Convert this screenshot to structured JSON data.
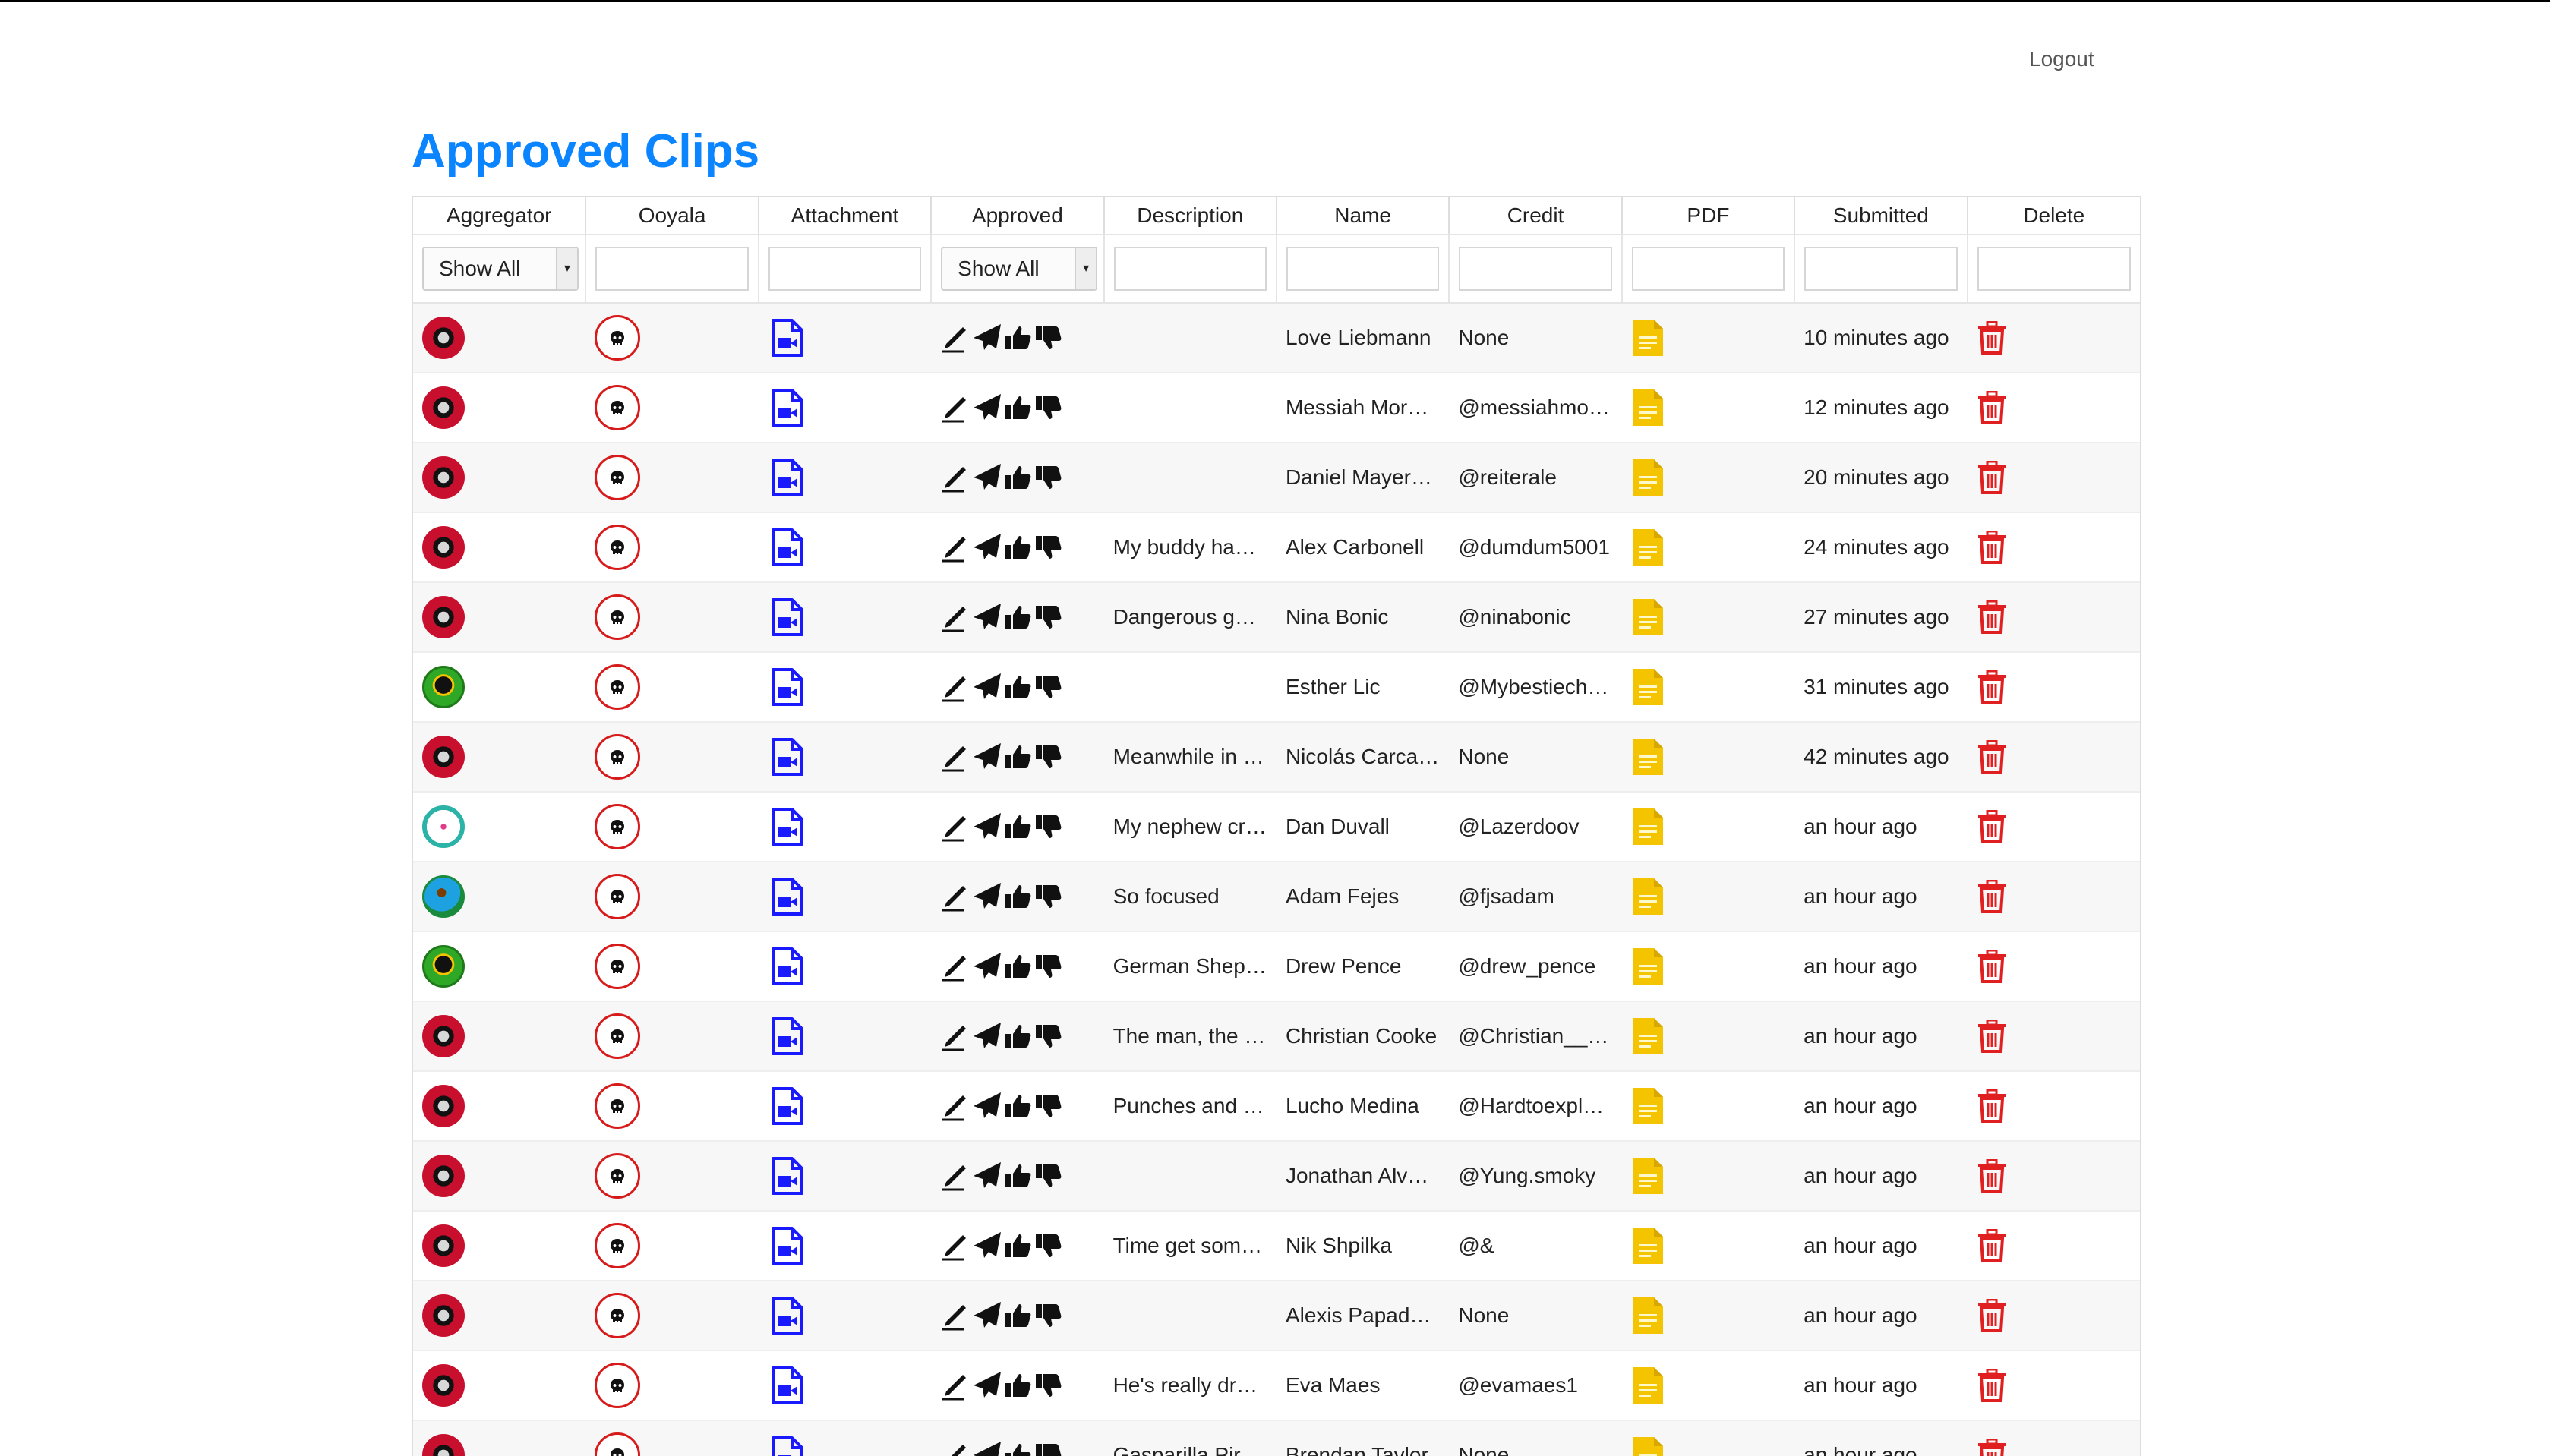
{
  "header": {
    "logout_label": "Logout"
  },
  "page": {
    "title": "Approved Clips"
  },
  "table": {
    "columns": [
      "Aggregator",
      "Ooyala",
      "Attachment",
      "Approved",
      "Description",
      "Name",
      "Credit",
      "PDF",
      "Submitted",
      "Delete"
    ],
    "filters": {
      "aggregator_selected": "Show All",
      "approved_selected": "Show All"
    },
    "rows": [
      {
        "agg": "red",
        "description": "",
        "name": "Love Liebmann",
        "credit": "None",
        "submitted": "10 minutes ago"
      },
      {
        "agg": "red",
        "description": "",
        "name": "Messiah More…",
        "credit": "@messiahmo…",
        "submitted": "12 minutes ago"
      },
      {
        "agg": "red",
        "description": "",
        "name": "Daniel Mayer…",
        "credit": "@reiterale",
        "submitted": "20 minutes ago"
      },
      {
        "agg": "red",
        "description": "My buddy ha…",
        "name": "Alex Carbonell",
        "credit": "@dumdum5001",
        "submitted": "24 minutes ago"
      },
      {
        "agg": "red",
        "description": "Dangerous ga…",
        "name": "Nina Bonic",
        "credit": "@ninabonic",
        "submitted": "27 minutes ago"
      },
      {
        "agg": "green",
        "description": "",
        "name": "Esther Lic",
        "credit": "@Mybestiech…",
        "submitted": "31 minutes ago"
      },
      {
        "agg": "red",
        "description": "Meanwhile in …",
        "name": "Nicolás Carca…",
        "credit": "None",
        "submitted": "42 minutes ago"
      },
      {
        "agg": "teal",
        "description": "My nephew cr…",
        "name": "Dan Duvall",
        "credit": "@Lazerdoov",
        "submitted": "an hour ago"
      },
      {
        "agg": "blue",
        "description": "So focused",
        "name": "Adam Fejes",
        "credit": "@fjsadam",
        "submitted": "an hour ago"
      },
      {
        "agg": "green",
        "description": "German Shep…",
        "name": "Drew Pence",
        "credit": "@drew_pence",
        "submitted": "an hour ago"
      },
      {
        "agg": "red",
        "description": "The man, the …",
        "name": "Christian Cooke",
        "credit": "@Christian__…",
        "submitted": "an hour ago"
      },
      {
        "agg": "red",
        "description": "Punches and …",
        "name": "Lucho Medina",
        "credit": "@Hardtoexpl…",
        "submitted": "an hour ago"
      },
      {
        "agg": "red",
        "description": "",
        "name": "Jonathan Alva…",
        "credit": "@Yung.smoky",
        "submitted": "an hour ago"
      },
      {
        "agg": "red",
        "description": "Time get som…",
        "name": "Nik Shpilka",
        "credit": "@&",
        "submitted": "an hour ago"
      },
      {
        "agg": "red",
        "description": "",
        "name": "Alexis Papad…",
        "credit": "None",
        "submitted": "an hour ago"
      },
      {
        "agg": "red",
        "description": "He's really dr…",
        "name": "Eva Maes",
        "credit": "@evamaes1",
        "submitted": "an hour ago"
      },
      {
        "agg": "red",
        "description": "Gasparilla Pir…",
        "name": "Brendan Taylor",
        "credit": "None",
        "submitted": "an hour ago"
      }
    ]
  },
  "icons": {
    "ooyala": "skull-icon",
    "attachment": "video-file-icon",
    "approved": [
      "pen-icon",
      "send-icon",
      "thumbs-up-icon",
      "thumbs-down-icon"
    ],
    "pdf": "document-icon",
    "delete": "trash-icon"
  },
  "colors": {
    "title": "#0a84ff",
    "attachment_icon": "#1a1aff",
    "pdf_icon": "#f5c400",
    "delete_icon": "#e02020",
    "ooyala_ring": "#d71a1a"
  }
}
